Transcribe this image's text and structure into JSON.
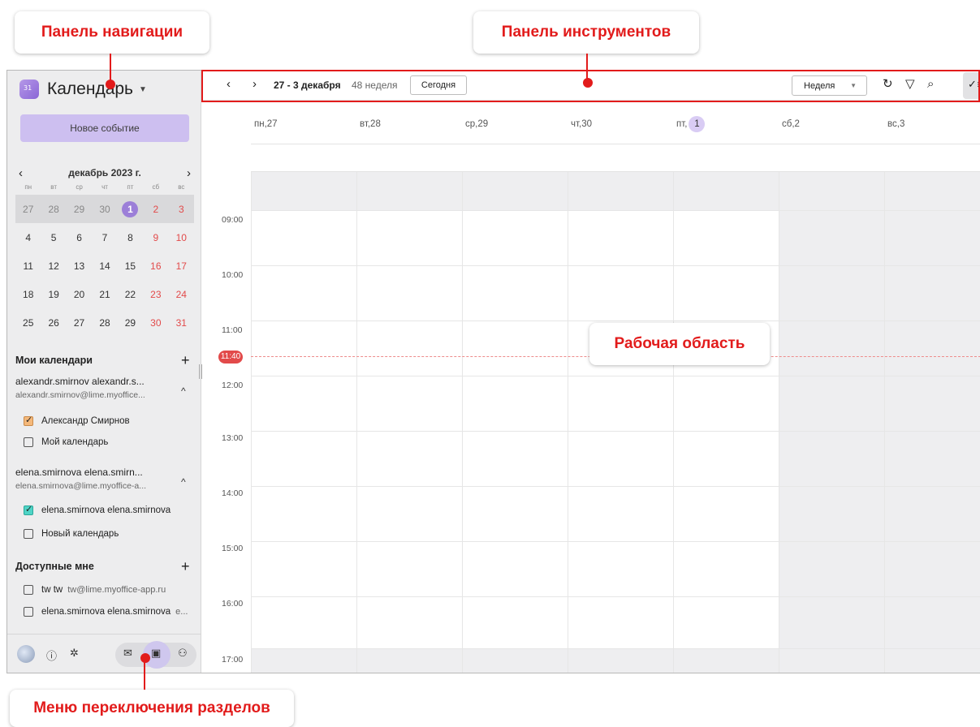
{
  "app": {
    "title": "Календарь"
  },
  "sidebar": {
    "new_event": "Новое событие",
    "mini_calendar": {
      "month": "декабрь 2023 г.",
      "dow": [
        "пн",
        "вт",
        "ср",
        "чт",
        "пт",
        "сб",
        "вс"
      ],
      "weeks": [
        [
          "27",
          "28",
          "29",
          "30",
          "1",
          "2",
          "3"
        ],
        [
          "4",
          "5",
          "6",
          "7",
          "8",
          "9",
          "10"
        ],
        [
          "11",
          "12",
          "13",
          "14",
          "15",
          "16",
          "17"
        ],
        [
          "18",
          "19",
          "20",
          "21",
          "22",
          "23",
          "24"
        ],
        [
          "25",
          "26",
          "27",
          "28",
          "29",
          "30",
          "31"
        ]
      ]
    },
    "my_calendars": {
      "title": "Мои календари",
      "accounts": [
        {
          "name": "alexandr.smirnov alexandr.s...",
          "email": "alexandr.smirnov@lime.myoffice...",
          "calendars": [
            {
              "label": "Александр Смирнов",
              "checked": true,
              "color": "#f4b87a"
            },
            {
              "label": "Мой календарь",
              "checked": false
            }
          ]
        },
        {
          "name": "elena.smirnova elena.smirn...",
          "email": "elena.smirnova@lime.myoffice-a...",
          "calendars": [
            {
              "label": "elena.smirnova elena.smirnova",
              "checked": true,
              "color": "#4fd4c6"
            },
            {
              "label": "Новый календарь",
              "checked": false
            }
          ]
        }
      ]
    },
    "shared": {
      "title": "Доступные мне",
      "items": [
        {
          "label": "tw tw",
          "sub": "tw@lime.myoffice-app.ru"
        },
        {
          "label": "elena.smirnova elena.smirnova",
          "sub": "e..."
        }
      ]
    }
  },
  "toolbar": {
    "range": "27 - 3 декабря",
    "week": "48 неделя",
    "today": "Сегодня",
    "view": "Неделя"
  },
  "days": [
    {
      "dow": "пн,",
      "num": "27"
    },
    {
      "dow": "вт,",
      "num": "28"
    },
    {
      "dow": "ср,",
      "num": "29"
    },
    {
      "dow": "чт,",
      "num": "30"
    },
    {
      "dow": "пт,",
      "num": "1",
      "today": true
    },
    {
      "dow": "сб,",
      "num": "2"
    },
    {
      "dow": "вс,",
      "num": "3"
    }
  ],
  "times": [
    "09:00",
    "10:00",
    "11:00",
    "12:00",
    "13:00",
    "14:00",
    "15:00",
    "16:00",
    "17:00"
  ],
  "now": "11:40",
  "annotations": {
    "nav_panel": "Панель навигации",
    "toolbar_panel": "Панель инструментов",
    "work_area": "Рабочая область",
    "section_menu": "Меню переключения разделов"
  },
  "colors": {
    "accent": "#9c7fd8",
    "annotation": "#e21b1b",
    "weekend": "#e24a4a"
  }
}
